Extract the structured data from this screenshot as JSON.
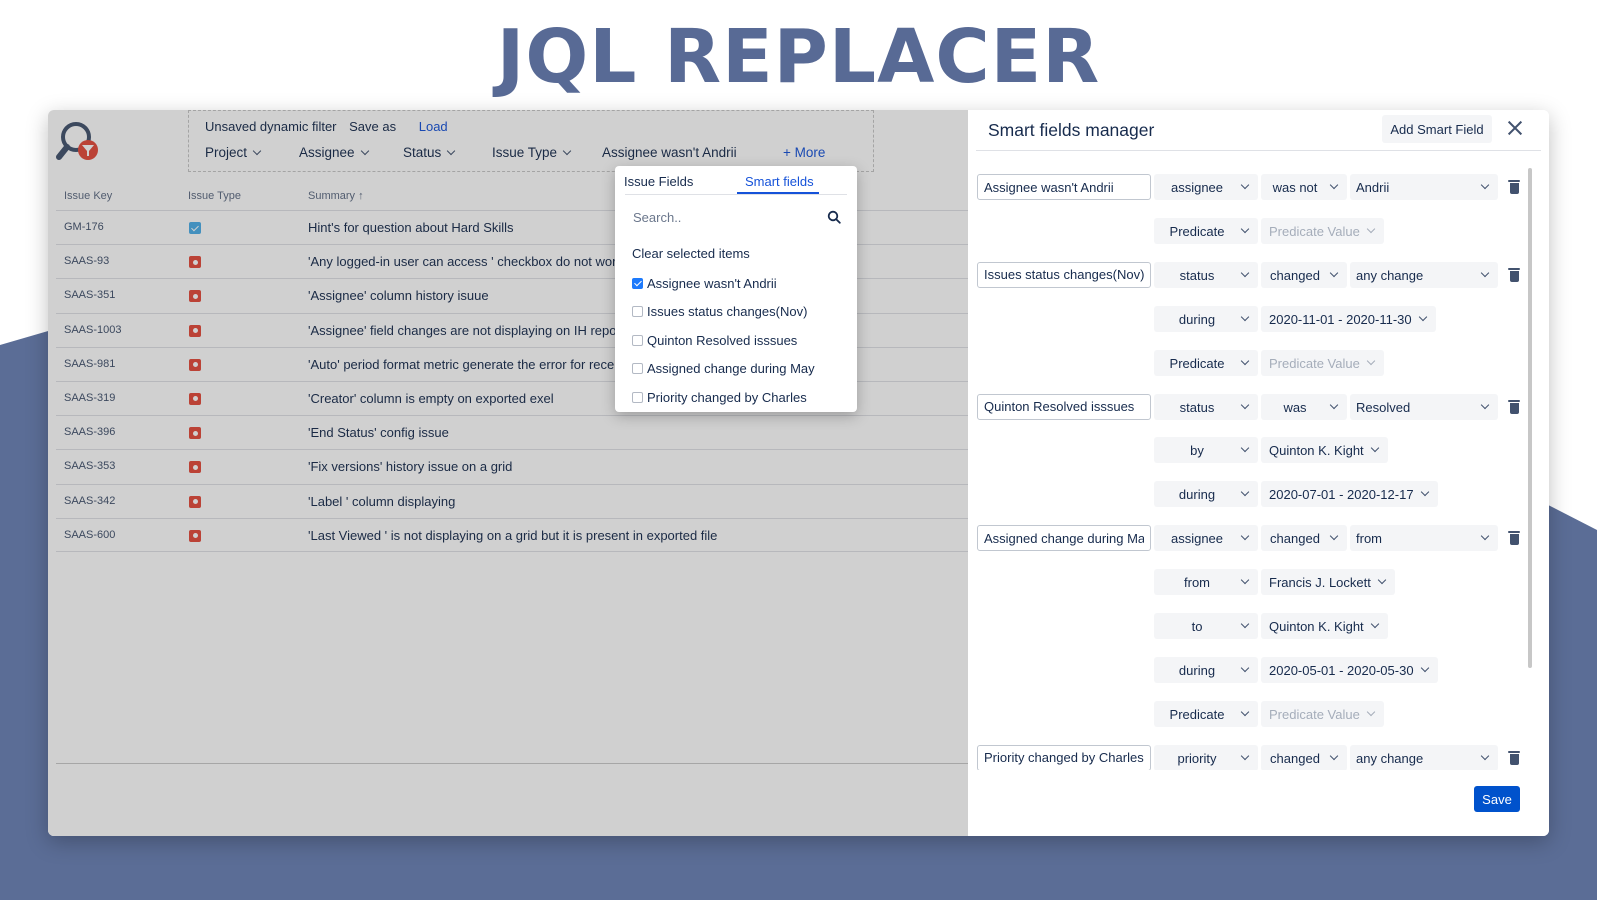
{
  "hero_title": "JQL REPLACER",
  "filter_bar": {
    "unsaved_label": "Unsaved dynamic filter",
    "save_as_label": "Save as",
    "load_label": "Load",
    "fields": [
      "Project",
      "Assignee",
      "Status",
      "Issue Type"
    ],
    "active_smart_filter": "Assignee wasn't Andrii",
    "more_label": "+ More"
  },
  "table": {
    "headers": [
      "Issue Key",
      "Issue Type",
      "Summary ↑"
    ],
    "rows": [
      {
        "key": "GM-176",
        "type": "task",
        "summary": "Hint's for question about Hard Skills"
      },
      {
        "key": "SAAS-93",
        "type": "bug",
        "summary": "'Any logged-in user can access ' checkbox do not work"
      },
      {
        "key": "SAAS-351",
        "type": "bug",
        "summary": "'Assignee' column history isuue"
      },
      {
        "key": "SAAS-1003",
        "type": "bug",
        "summary": "'Assignee' field changes are not displaying on IH report"
      },
      {
        "key": "SAAS-981",
        "type": "bug",
        "summary": "'Auto' period format metric generate the error for recentl"
      },
      {
        "key": "SAAS-319",
        "type": "bug",
        "summary": "'Creator' column is empty on exported exel"
      },
      {
        "key": "SAAS-396",
        "type": "bug",
        "summary": "'End Status' config issue"
      },
      {
        "key": "SAAS-353",
        "type": "bug",
        "summary": "'Fix versions' history issue on a grid"
      },
      {
        "key": "SAAS-342",
        "type": "bug",
        "summary": "'Label ' column displaying"
      },
      {
        "key": "SAAS-600",
        "type": "bug",
        "summary": "'Last Viewed ' is not displaying on a grid but it is present in exported file"
      }
    ]
  },
  "popup": {
    "tabs": [
      "Issue Fields",
      "Smart fields"
    ],
    "active_tab": 1,
    "search_placeholder": "Search..",
    "clear_label": "Clear selected items",
    "items": [
      {
        "label": "Assignee wasn't Andrii",
        "checked": true
      },
      {
        "label": "Issues status changes(Nov)",
        "checked": false
      },
      {
        "label": "Quinton Resolved isssues",
        "checked": false
      },
      {
        "label": "Assigned change during May",
        "checked": false
      },
      {
        "label": "Priority changed by Charles",
        "checked": false
      }
    ]
  },
  "panel": {
    "title": "Smart fields manager",
    "add_button": "Add Smart Field",
    "save_button": "Save",
    "field_names": [
      "Assignee wasn't Andrii",
      "Issues status changes(Nov)",
      "Quinton Resolved isssues",
      "Assigned change during May",
      "Priority changed by Charles"
    ],
    "rows": [
      {
        "field": 0,
        "c1": "assignee",
        "c2": "was not",
        "c3": "Andrii"
      },
      {
        "c1": "Predicate",
        "c2p": "Predicate Value",
        "disabled": true
      },
      {
        "field": 1,
        "c1": "status",
        "c2": "changed",
        "c3": "any change"
      },
      {
        "c1": "during",
        "c2p": "2020-11-01 - 2020-11-30"
      },
      {
        "c1": "Predicate",
        "c2p": "Predicate Value",
        "disabled": true
      },
      {
        "field": 2,
        "c1": "status",
        "c2": "was",
        "c3": "Resolved"
      },
      {
        "c1": "by",
        "c2p": "Quinton K. Kight"
      },
      {
        "c1": "during",
        "c2p": "2020-07-01 - 2020-12-17"
      },
      {
        "field": 3,
        "c1": "assignee",
        "c2": "changed",
        "c3": "from"
      },
      {
        "c1": "from",
        "c2p": "Francis J. Lockett"
      },
      {
        "c1": "to",
        "c2p": "Quinton K. Kight"
      },
      {
        "c1": "during",
        "c2p": "2020-05-01 - 2020-05-30"
      },
      {
        "c1": "Predicate",
        "c2p": "Predicate Value",
        "disabled": true
      },
      {
        "field": 4,
        "c1": "priority",
        "c2": "changed",
        "c3": "any change"
      }
    ]
  },
  "colors": {
    "background_band": "#5b6d96",
    "title": "#586a95",
    "primary": "#0052cc",
    "link": "#1552d9",
    "bug": "#e5493a",
    "task": "#4bade8"
  },
  "icons": [
    "jql-replacer-logo-icon",
    "chevron-down-icon",
    "search-icon",
    "close-icon",
    "trash-icon",
    "checkbox-icon",
    "task-type-icon",
    "bug-type-icon"
  ]
}
